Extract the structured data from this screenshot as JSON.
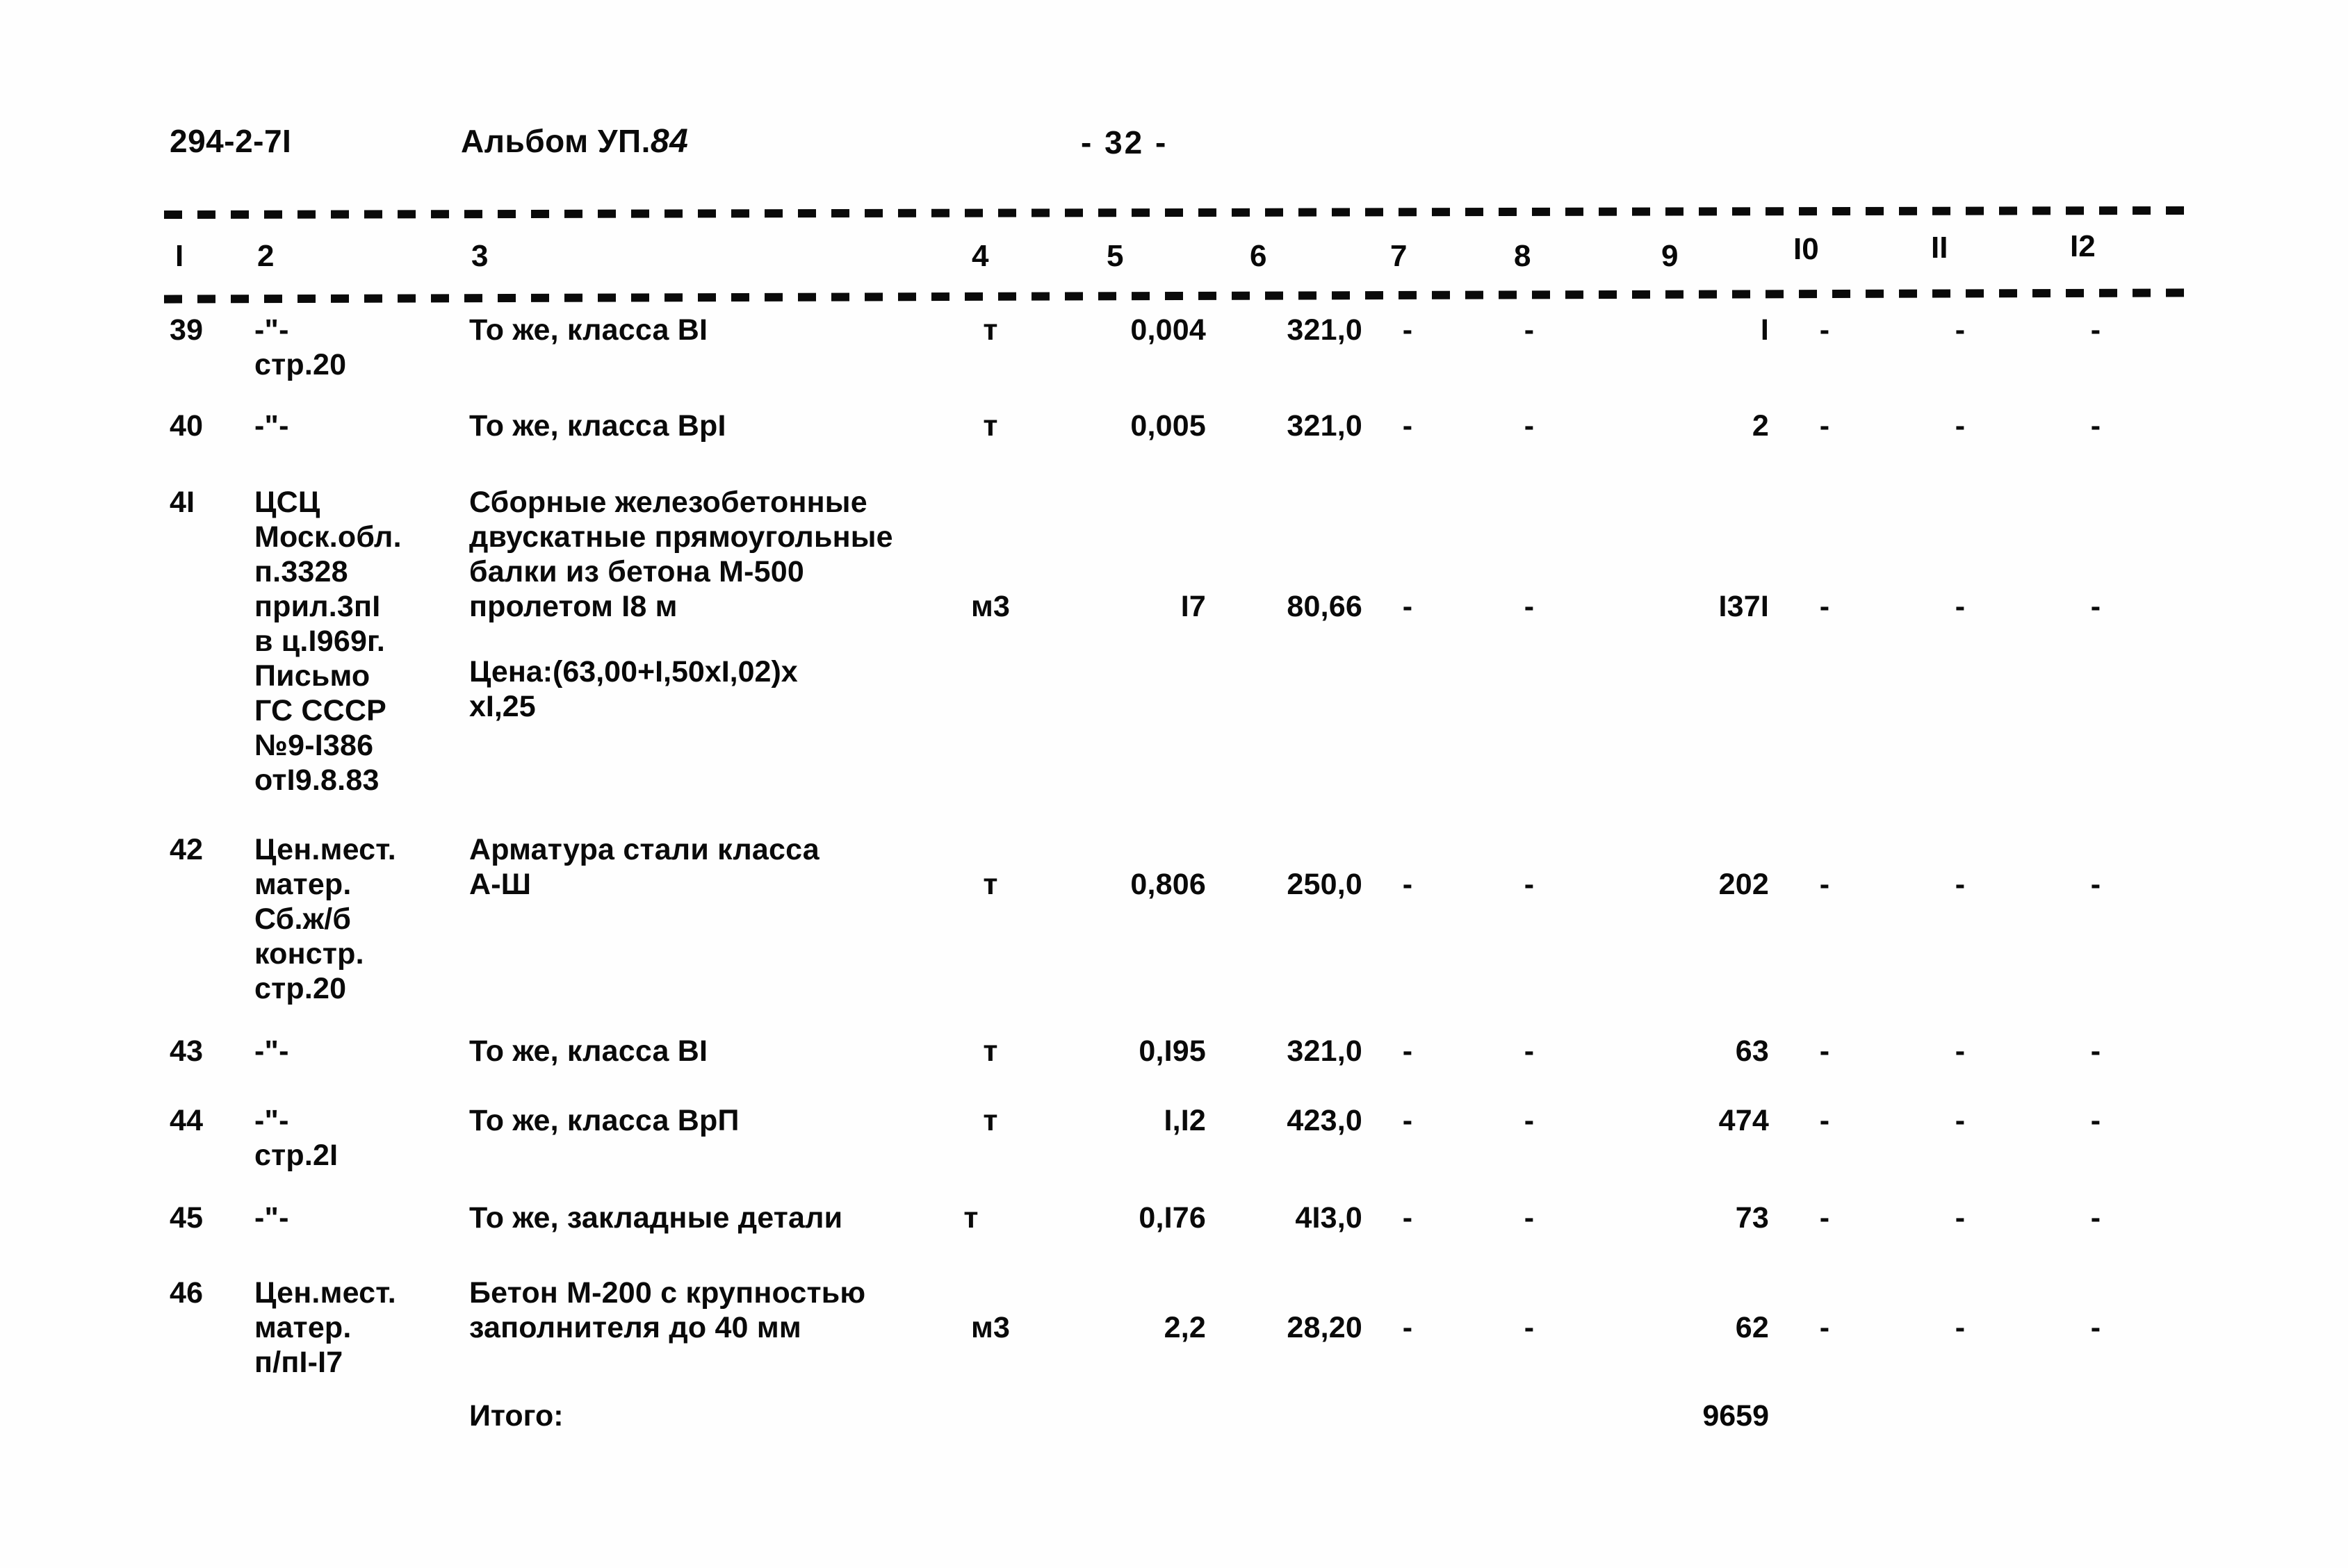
{
  "header": {
    "doc_code": "294-2-7I",
    "album_label": "Альбом УП.",
    "album_number": "84",
    "page_marker": "- 32 -"
  },
  "table": {
    "column_numbers": [
      "I",
      "2",
      "3",
      "4",
      "5",
      "6",
      "7",
      "8",
      "9",
      "I0",
      "II",
      "I2"
    ],
    "dash": "-",
    "total_label": "Итого:",
    "total_value": "9659",
    "rows": [
      {
        "no": "39",
        "source": "-\"-\nстр.20",
        "description": "То же, класса ВI",
        "unit": "т",
        "qty": "0,004",
        "price": "321,0",
        "c7": "-",
        "c8": "-",
        "c9": "I",
        "c10": "-",
        "c11": "-",
        "c12": "-"
      },
      {
        "no": "40",
        "source": "-\"-",
        "description": "То же, класса ВрI",
        "unit": "т",
        "qty": "0,005",
        "price": "321,0",
        "c7": "-",
        "c8": "-",
        "c9": "2",
        "c10": "-",
        "c11": "-",
        "c12": "-"
      },
      {
        "no": "4I",
        "source": "ЦСЦ\nМоск.обл.\nп.3328\nприл.3пI\nв ц.I969г.\nПисьмо\nГС СССР\n№9-I386\nотI9.8.83",
        "description": "Сборные железобетонные\nдвускатные прямоугольные\nбалки из бетона М-500\nпролетом I8 м",
        "description_note": "Цена:(63,00+I,50xI,02)x\nxI,25",
        "unit": "м3",
        "qty": "I7",
        "price": "80,66",
        "c7": "-",
        "c8": "-",
        "c9": "I37I",
        "c10": "-",
        "c11": "-",
        "c12": "-"
      },
      {
        "no": "42",
        "source": "Цен.мест.\nматер.\nСб.ж/б\nконстр.\nстр.20",
        "description": "Арматура стали класса\nА-Ш",
        "unit": "т",
        "qty": "0,806",
        "price": "250,0",
        "c7": "-",
        "c8": "-",
        "c9": "202",
        "c10": "-",
        "c11": "-",
        "c12": "-"
      },
      {
        "no": "43",
        "source": "-\"-",
        "description": "То же, класса ВI",
        "unit": "т",
        "qty": "0,I95",
        "price": "321,0",
        "c7": "-",
        "c8": "-",
        "c9": "63",
        "c10": "-",
        "c11": "-",
        "c12": "-"
      },
      {
        "no": "44",
        "source": "-\"-\nстр.2I",
        "description": "То же, класса ВрП",
        "unit": "т",
        "qty": "I,I2",
        "price": "423,0",
        "c7": "-",
        "c8": "-",
        "c9": "474",
        "c10": "-",
        "c11": "-",
        "c12": "-"
      },
      {
        "no": "45",
        "source": "-\"-",
        "description": "То же, закладные детали",
        "unit": "т",
        "qty": "0,I76",
        "price": "4I3,0",
        "c7": "-",
        "c8": "-",
        "c9": "73",
        "c10": "-",
        "c11": "-",
        "c12": "-"
      },
      {
        "no": "46",
        "source": "Цен.мест.\nматер.\nп/пI-I7",
        "description": "Бетон М-200 с крупностью\nзаполнителя до 40 мм",
        "unit": "м3",
        "qty": "2,2",
        "price": "28,20",
        "c7": "-",
        "c8": "-",
        "c9": "62",
        "c10": "-",
        "c11": "-",
        "c12": "-"
      }
    ]
  }
}
